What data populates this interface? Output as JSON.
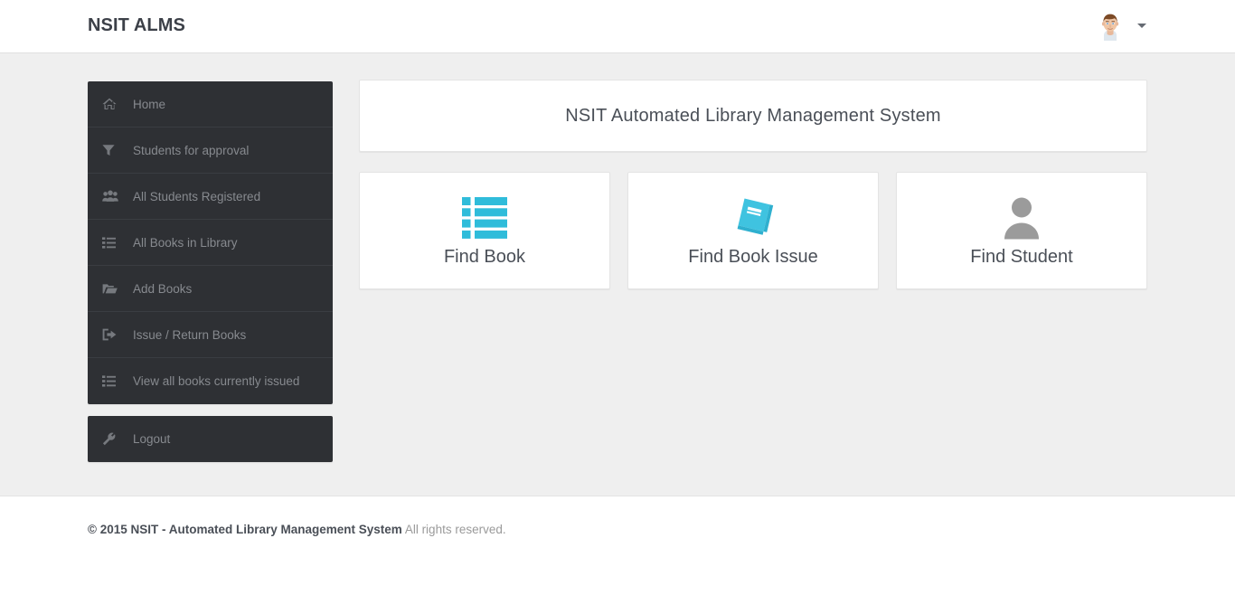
{
  "header": {
    "brand": "NSIT ALMS",
    "avatar_icon": "user-avatar-photo",
    "caret_icon": "chevron-down-icon"
  },
  "sidebar": {
    "groups": [
      {
        "items": [
          {
            "label": "Home",
            "icon": "home-icon"
          },
          {
            "label": "Students for approval",
            "icon": "filter-icon"
          },
          {
            "label": "All Students Registered",
            "icon": "users-group-icon"
          },
          {
            "label": "All Books in Library",
            "icon": "list-icon"
          },
          {
            "label": "Add Books",
            "icon": "folder-open-icon"
          },
          {
            "label": "Issue / Return Books",
            "icon": "sign-out-icon"
          },
          {
            "label": "View all books currently issued",
            "icon": "list-icon"
          }
        ]
      },
      {
        "items": [
          {
            "label": "Logout",
            "icon": "wrench-icon"
          }
        ]
      }
    ]
  },
  "main": {
    "title": "NSIT Automated Library Management System",
    "cards": [
      {
        "label": "Find Book",
        "icon": "th-list-icon",
        "color": "#2fbcda"
      },
      {
        "label": "Find Book Issue",
        "icon": "book-icon",
        "color": "#2fbcda"
      },
      {
        "label": "Find Student",
        "icon": "user-icon",
        "color": "#9b9b9b"
      }
    ]
  },
  "footer": {
    "copyright": "© 2015 NSIT - Automated Library Management System",
    "rights": "All rights reserved."
  },
  "colors": {
    "accent": "#2fbcda",
    "sidebar_bg": "#2e3034",
    "sidebar_text": "#878a8f",
    "page_bg": "#efefef",
    "text": "#4a4f57"
  }
}
